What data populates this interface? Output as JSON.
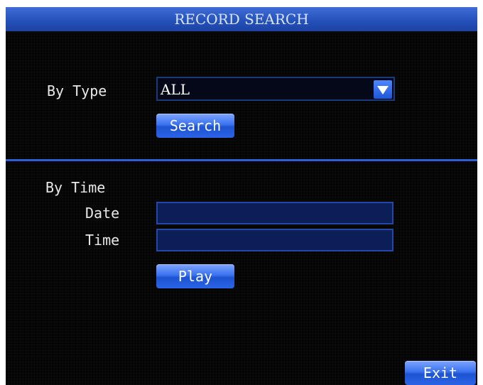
{
  "title": "RECORD SEARCH",
  "by_type": {
    "label": "By Type",
    "selected_value": "ALL",
    "search_label": "Search"
  },
  "by_time": {
    "label": "By Time",
    "date_label": "Date",
    "date_value": "",
    "time_label": "Time",
    "time_value": "",
    "play_label": "Play"
  },
  "exit_label": "Exit",
  "colors": {
    "accent": "#2e5fd6",
    "background": "#050506",
    "field": "#0b1e56"
  },
  "icons": {
    "dropdown": "chevron-down-icon"
  }
}
